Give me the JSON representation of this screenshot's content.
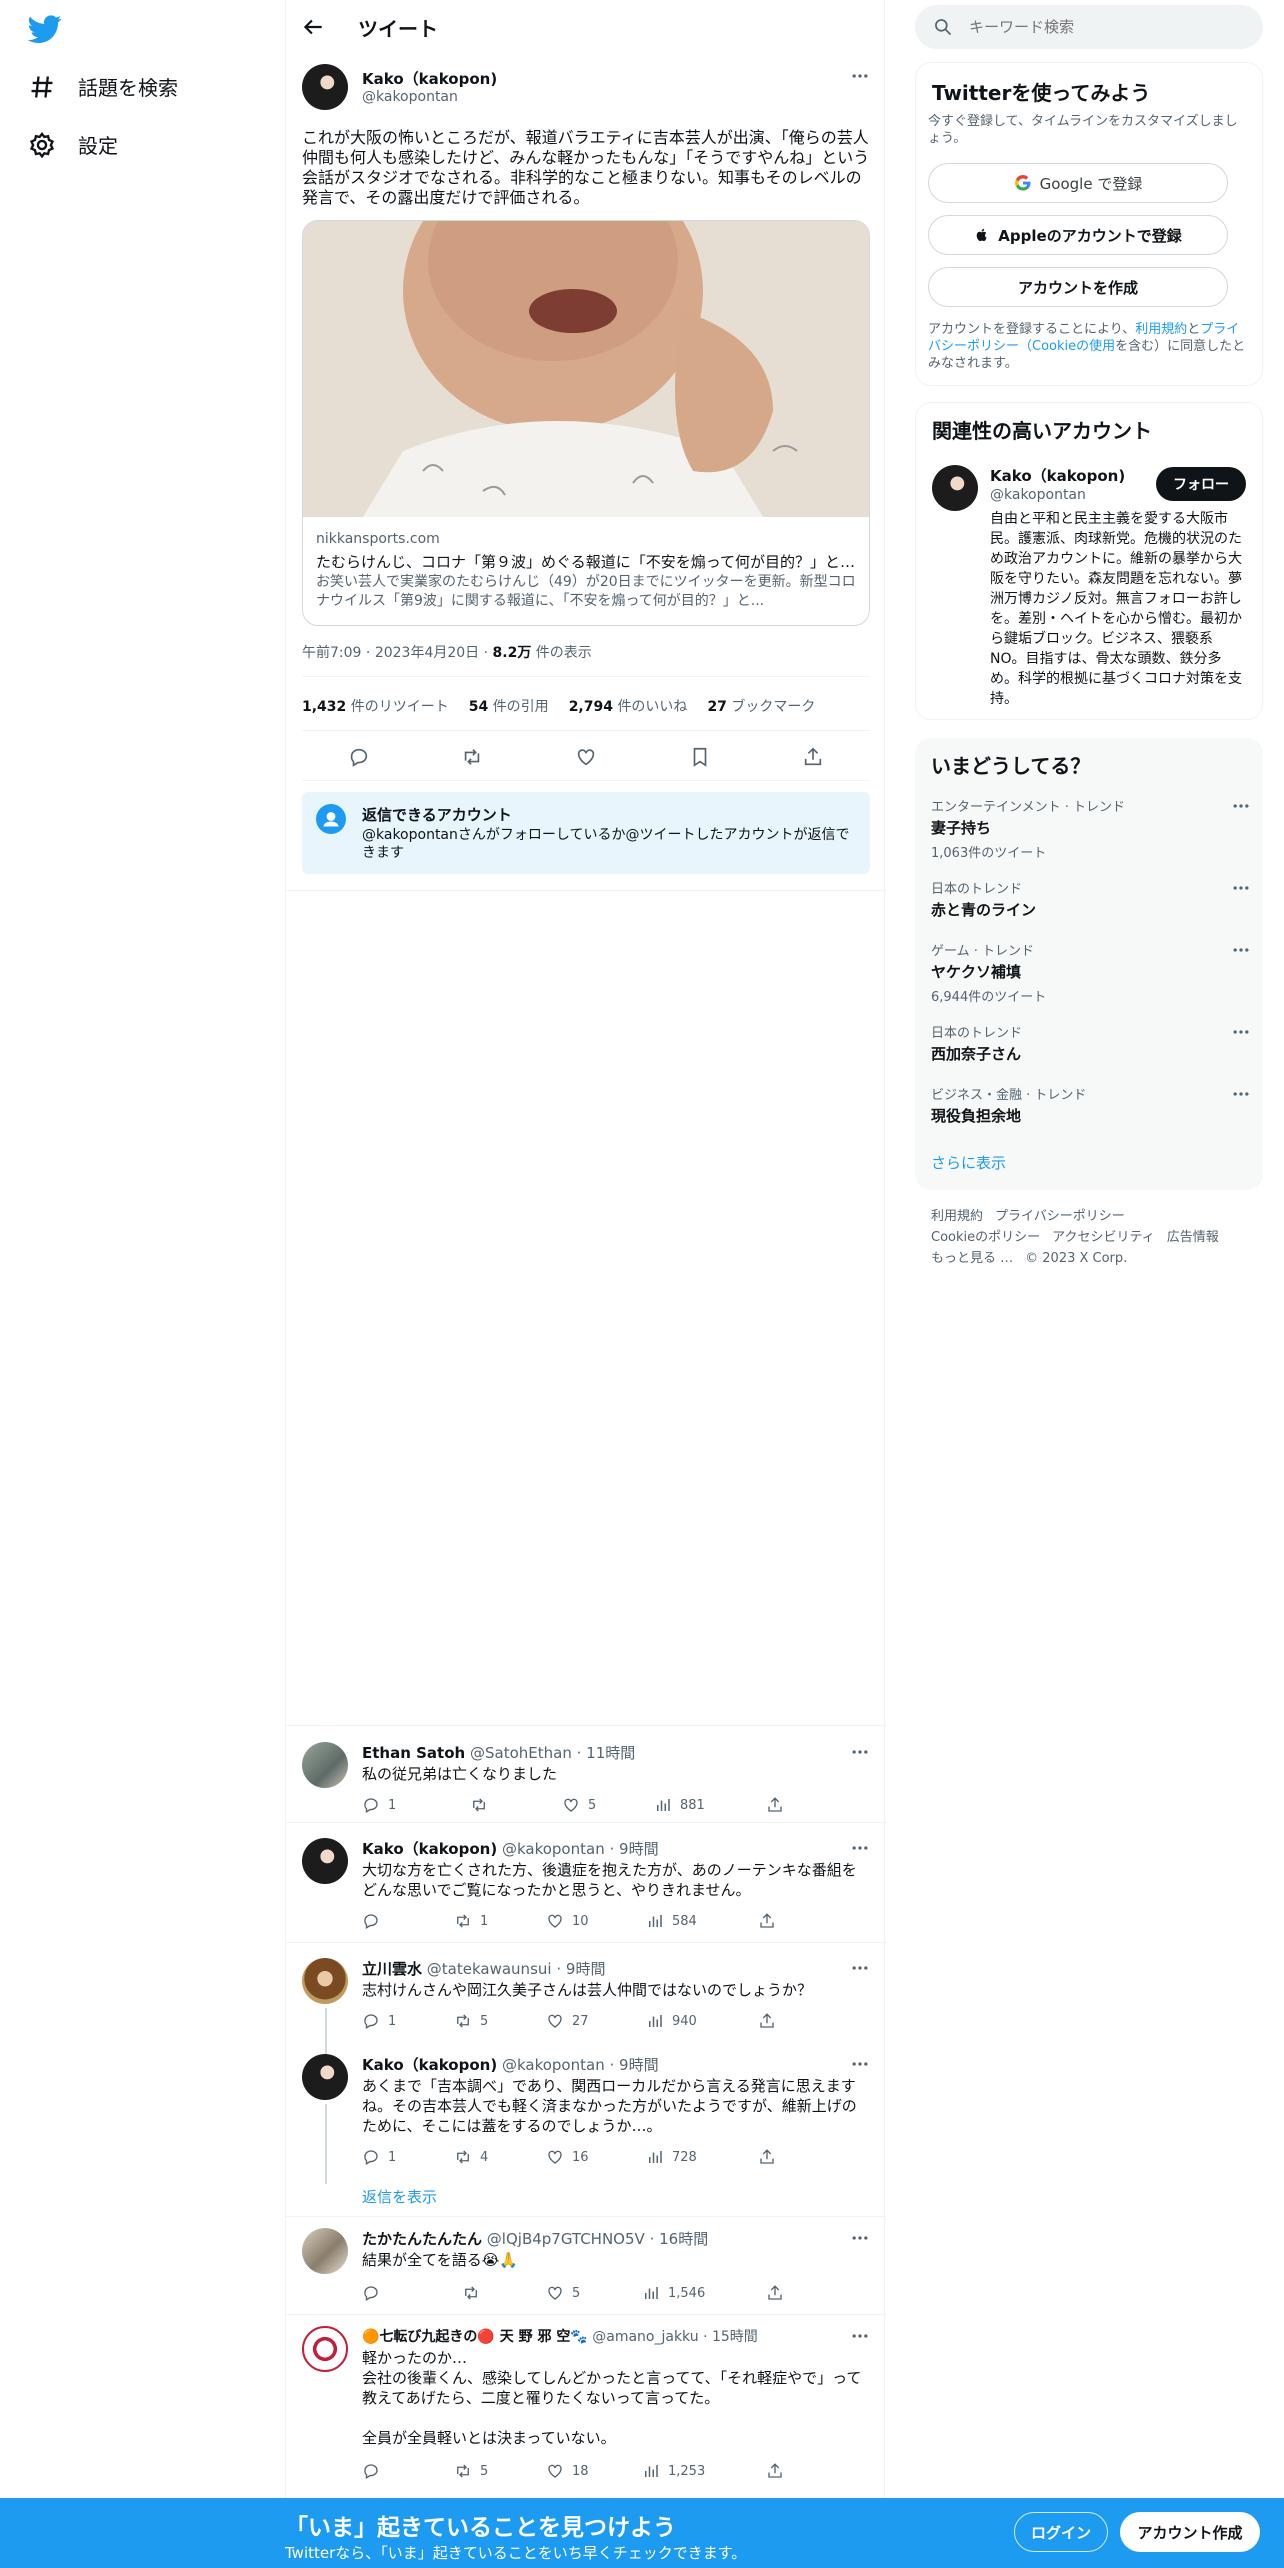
{
  "nav": {
    "explore_label": "話題を検索",
    "settings_label": "設定"
  },
  "header": {
    "title": "ツイート"
  },
  "tweet": {
    "author_name": "Kako（kakopon)",
    "author_handle": "@kakopontan",
    "text": "これが大阪の怖いところだが、報道バラエティに吉本芸人が出演、「俺らの芸人仲間も何人も感染したけど、みんな軽かったもんな」「そうですやんね」という会話がスタジオでなされる。非科学的なこと極まりない。知事もそのレベルの発言で、その露出度だけで評価される。",
    "card": {
      "domain": "nikkansports.com",
      "title": "たむらけんじ、コロナ「第９波」めぐる報道に「不安を煽って何が目的？」と…",
      "description": "お笑い芸人で実業家のたむらけんじ（49）が20日までにツイッターを更新。新型コロナウイルス「第9波」に関する報道に、「不安を煽って何が目的？」と..."
    },
    "time": "午前7:09",
    "date": "2023年4月20日",
    "views_value": "8.2万",
    "views_label": "件の表示",
    "stats": [
      {
        "value": "1,432",
        "label": "件のリツイート"
      },
      {
        "value": "54",
        "label": "件の引用"
      },
      {
        "value": "2,794",
        "label": "件のいいね"
      },
      {
        "value": "27",
        "label": "ブックマーク"
      }
    ]
  },
  "reply_restriction": {
    "title": "返信できるアカウント",
    "description": "@kakopontanさんがフォローしているか@ツイートしたアカウントが返信できます"
  },
  "replies": [
    {
      "name": "Ethan Satoh",
      "handle": "@SatohEthan",
      "time": "11時間",
      "text": "私の従兄弟は亡くなりました",
      "reply": "1",
      "retweet": "",
      "like": "5",
      "views": "881"
    },
    {
      "name": "Kako（kakopon)",
      "handle": "@kakopontan",
      "time": "9時間",
      "text": "大切な方を亡くされた方、後遺症を抱えた方が、あのノーテンキな番組をどんな思いでご覧になったかと思うと、やりきれません。",
      "reply": "",
      "retweet": "1",
      "like": "10",
      "views": "584"
    },
    {
      "name": "立川雲水",
      "handle": "@tatekawaunsui",
      "time": "9時間",
      "text": "志村けんさんや岡江久美子さんは芸人仲間ではないのでしょうか？",
      "reply": "1",
      "retweet": "5",
      "like": "27",
      "views": "940"
    },
    {
      "name": "Kako（kakopon)",
      "handle": "@kakopontan",
      "time": "9時間",
      "text": "あくまで「吉本調べ」であり、関西ローカルだから言える発言に思えますね。その吉本芸人でも軽く済まなかった方がいたようですが、維新上げのために、そこには蓋をするのでしょうか…。",
      "reply": "1",
      "retweet": "4",
      "like": "16",
      "views": "728"
    },
    {
      "name": "たかたんたんたん",
      "handle": "@lQjB4p7GTCHNO5V",
      "time": "16時間",
      "text": "結果が全てを語る😭🙏",
      "reply": "",
      "retweet": "",
      "like": "5",
      "views": "1,546"
    },
    {
      "name": "🟠七転び九起きの🔴 天 野 邪 空🐾",
      "handle": "@amano_jakku",
      "time": "15時間",
      "text": "軽かったのか…\n会社の後輩くん、感染してしんどかったと言ってて、「それ軽症やで」って教えてあげたら、二度と罹りたくないって言ってた。\n\n全員が全員軽いとは決まっていない。",
      "reply": "",
      "retweet": "5",
      "like": "18",
      "views": "1,253"
    }
  ],
  "show_replies_label": "返信を表示",
  "search": {
    "placeholder": "キーワード検索"
  },
  "signup": {
    "title": "Twitterを使ってみよう",
    "subtitle": "今すぐ登録して、タイムラインをカスタマイズしましょう。",
    "google_label": "Google で登録",
    "apple_label": "Appleのアカウントで登録",
    "create_label": "アカウントを作成",
    "legal_prefix": "アカウントを登録することにより、",
    "legal_terms": "利用規約",
    "legal_and": "と",
    "legal_privacy": "プライバシーポリシー（Cookieの使用",
    "legal_suffix": "を含む）に同意したとみなされます。"
  },
  "related": {
    "title": "関連性の高いアカウント",
    "name": "Kako（kakopon)",
    "handle": "@kakopontan",
    "follow_label": "フォロー",
    "bio": "自由と平和と民主主義を愛する大阪市民。護憲派、肉球新党。危機的状況のため政治アカウントに。維新の暴挙から大阪を守りたい。森友問題を忘れない。夢洲万博カジノ反対。無言フォローお許しを。差別・ヘイトを心から憎む。最初から鍵垢ブロック。ビジネス、猥褻系NO。目指すは、骨太な頭数、鉄分多め。科学的根拠に基づくコロナ対策を支持。"
  },
  "trends": {
    "title": "いまどうしてる？",
    "items": [
      {
        "category": "エンターテインメント · トレンド",
        "name": "妻子持ち",
        "count": "1,063件のツイート"
      },
      {
        "category": "日本のトレンド",
        "name": "赤と青のライン",
        "count": ""
      },
      {
        "category": "ゲーム · トレンド",
        "name": "ヤケクソ補填",
        "count": "6,944件のツイート"
      },
      {
        "category": "日本のトレンド",
        "name": "西加奈子さん",
        "count": ""
      },
      {
        "category": "ビジネス・金融 · トレンド",
        "name": "現役負担余地",
        "count": ""
      }
    ],
    "show_more": "さらに表示"
  },
  "footer": {
    "links": [
      "利用規約",
      "プライバシーポリシー",
      "Cookieのポリシー",
      "アクセシビリティ",
      "広告情報",
      "もっと見る …",
      "© 2023 X Corp."
    ]
  },
  "bottombar": {
    "title": "「いま」起きていることを見つけよう",
    "subtitle": "Twitterなら、「いま」起きていることをいち早くチェックできます。",
    "login_label": "ログイン",
    "signup_label": "アカウント作成"
  },
  "colors": {
    "accent": "#1d9bf0",
    "text": "#0f1419",
    "muted": "#536471"
  }
}
